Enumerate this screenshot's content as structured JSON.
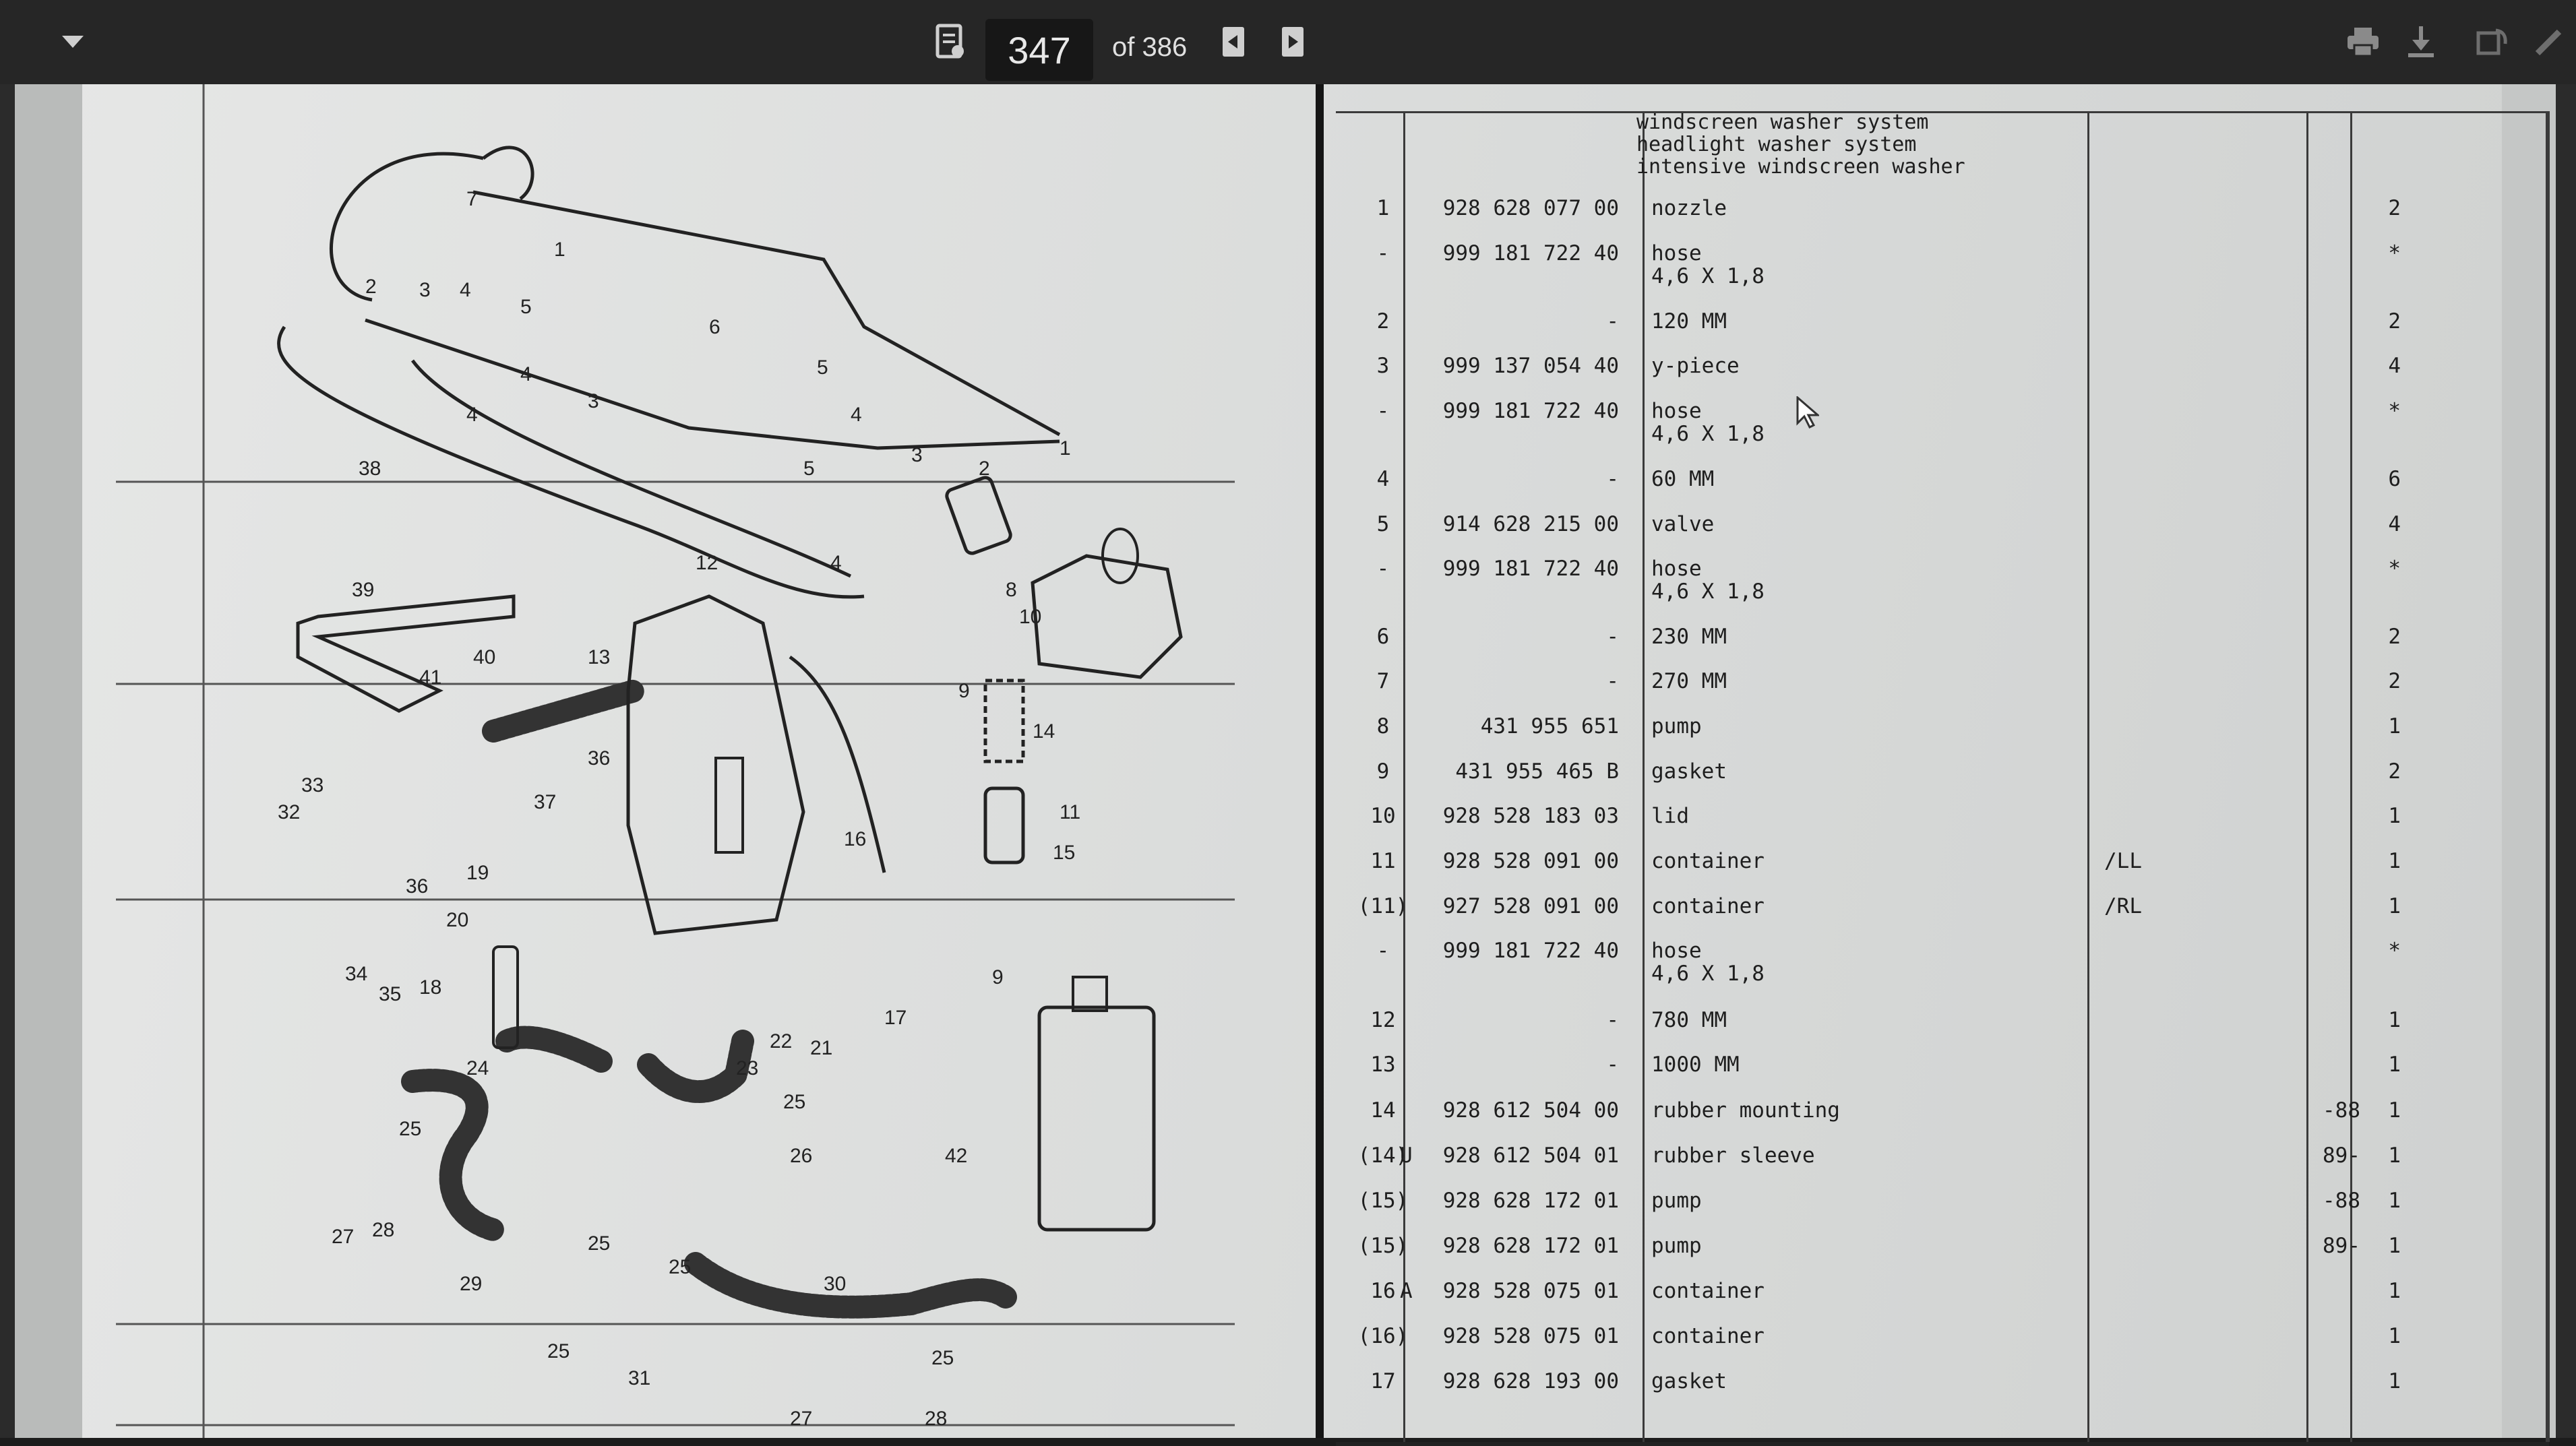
{
  "toolbar": {
    "current_page": "347",
    "total_pages": "of 386",
    "icons": [
      "menu-dropdown-icon",
      "document-properties-icon",
      "previous-page-icon",
      "next-page-icon",
      "print-icon",
      "download-icon",
      "rotate-icon",
      "edit-icon"
    ]
  },
  "catalog": {
    "header_lines": [
      "windscreen washer system",
      "headlight washer system",
      "intensive windscreen washer"
    ],
    "rows": [
      {
        "ref": "1",
        "mark": "",
        "part": "928 628 077 00",
        "desc": "nozzle",
        "desc2": "",
        "remark": "",
        "model": "",
        "qty": "2"
      },
      {
        "ref": "-",
        "mark": "",
        "part": "999 181 722 40",
        "desc": "hose",
        "desc2": "4,6 X 1,8",
        "remark": "",
        "model": "",
        "qty": "*"
      },
      {
        "ref": "2",
        "mark": "",
        "part": "-",
        "desc": "120 MM",
        "desc2": "",
        "remark": "",
        "model": "",
        "qty": "2"
      },
      {
        "ref": "3",
        "mark": "",
        "part": "999 137 054 40",
        "desc": "y-piece",
        "desc2": "",
        "remark": "",
        "model": "",
        "qty": "4"
      },
      {
        "ref": "-",
        "mark": "",
        "part": "999 181 722 40",
        "desc": "hose",
        "desc2": "4,6 X 1,8",
        "remark": "",
        "model": "",
        "qty": "*"
      },
      {
        "ref": "4",
        "mark": "",
        "part": "-",
        "desc": "60 MM",
        "desc2": "",
        "remark": "",
        "model": "",
        "qty": "6"
      },
      {
        "ref": "5",
        "mark": "",
        "part": "914 628 215 00",
        "desc": "valve",
        "desc2": "",
        "remark": "",
        "model": "",
        "qty": "4"
      },
      {
        "ref": "-",
        "mark": "",
        "part": "999 181 722 40",
        "desc": "hose",
        "desc2": "4,6 X 1,8",
        "remark": "",
        "model": "",
        "qty": "*"
      },
      {
        "ref": "6",
        "mark": "",
        "part": "-",
        "desc": "230 MM",
        "desc2": "",
        "remark": "",
        "model": "",
        "qty": "2"
      },
      {
        "ref": "7",
        "mark": "",
        "part": "-",
        "desc": "270 MM",
        "desc2": "",
        "remark": "",
        "model": "",
        "qty": "2"
      },
      {
        "ref": "8",
        "mark": "",
        "part": "431 955 651",
        "desc": "pump",
        "desc2": "",
        "remark": "",
        "model": "",
        "qty": "1"
      },
      {
        "ref": "9",
        "mark": "",
        "part": "431 955 465 B",
        "desc": "gasket",
        "desc2": "",
        "remark": "",
        "model": "",
        "qty": "2"
      },
      {
        "ref": "10",
        "mark": "",
        "part": "928 528 183 03",
        "desc": "lid",
        "desc2": "",
        "remark": "",
        "model": "",
        "qty": "1"
      },
      {
        "ref": "11",
        "mark": "",
        "part": "928 528 091 00",
        "desc": "container",
        "desc2": "",
        "remark": "/LL",
        "model": "",
        "qty": "1"
      },
      {
        "ref": "(11)",
        "mark": "",
        "part": "927 528 091 00",
        "desc": "container",
        "desc2": "",
        "remark": "/RL",
        "model": "",
        "qty": "1"
      },
      {
        "ref": "-",
        "mark": "",
        "part": "999 181 722 40",
        "desc": "hose",
        "desc2": "4,6 X 1,8",
        "remark": "",
        "model": "",
        "qty": "*"
      },
      {
        "ref": "12",
        "mark": "",
        "part": "-",
        "desc": "780 MM",
        "desc2": "",
        "remark": "",
        "model": "",
        "qty": "1"
      },
      {
        "ref": "13",
        "mark": "",
        "part": "-",
        "desc": "1000 MM",
        "desc2": "",
        "remark": "",
        "model": "",
        "qty": "1"
      },
      {
        "ref": "14",
        "mark": "",
        "part": "928 612 504 00",
        "desc": "rubber mounting",
        "desc2": "",
        "remark": "",
        "model": "-88",
        "qty": "1"
      },
      {
        "ref": "(14)",
        "mark": "U",
        "part": "928 612 504 01",
        "desc": "rubber sleeve",
        "desc2": "",
        "remark": "",
        "model": "89-",
        "qty": "1"
      },
      {
        "ref": "(15)",
        "mark": "",
        "part": "928 628 172 01",
        "desc": "pump",
        "desc2": "",
        "remark": "",
        "model": "-88",
        "qty": "1"
      },
      {
        "ref": "(15)",
        "mark": "",
        "part": "928 628 172 01",
        "desc": "pump",
        "desc2": "",
        "remark": "",
        "model": "89-",
        "qty": "1"
      },
      {
        "ref": "16",
        "mark": "A",
        "part": "928 528 075 01",
        "desc": "container",
        "desc2": "",
        "remark": "",
        "model": "",
        "qty": "1"
      },
      {
        "ref": "(16)",
        "mark": "",
        "part": "928 528 075 01",
        "desc": "container",
        "desc2": "",
        "remark": "",
        "model": "",
        "qty": "1"
      },
      {
        "ref": "17",
        "mark": "",
        "part": "928 628 193 00",
        "desc": "gasket",
        "desc2": "",
        "remark": "",
        "model": "",
        "qty": "1"
      }
    ]
  },
  "diagram": {
    "callouts": [
      "1",
      "2",
      "3",
      "4",
      "5",
      "6",
      "7",
      "8",
      "9",
      "10",
      "11",
      "12",
      "13",
      "14",
      "15",
      "16",
      "17",
      "18",
      "19",
      "20",
      "21",
      "22",
      "23",
      "24",
      "25",
      "26",
      "27",
      "28",
      "29",
      "30",
      "31",
      "32",
      "33",
      "34",
      "35",
      "36",
      "37",
      "38",
      "39",
      "40",
      "41",
      "42"
    ]
  }
}
